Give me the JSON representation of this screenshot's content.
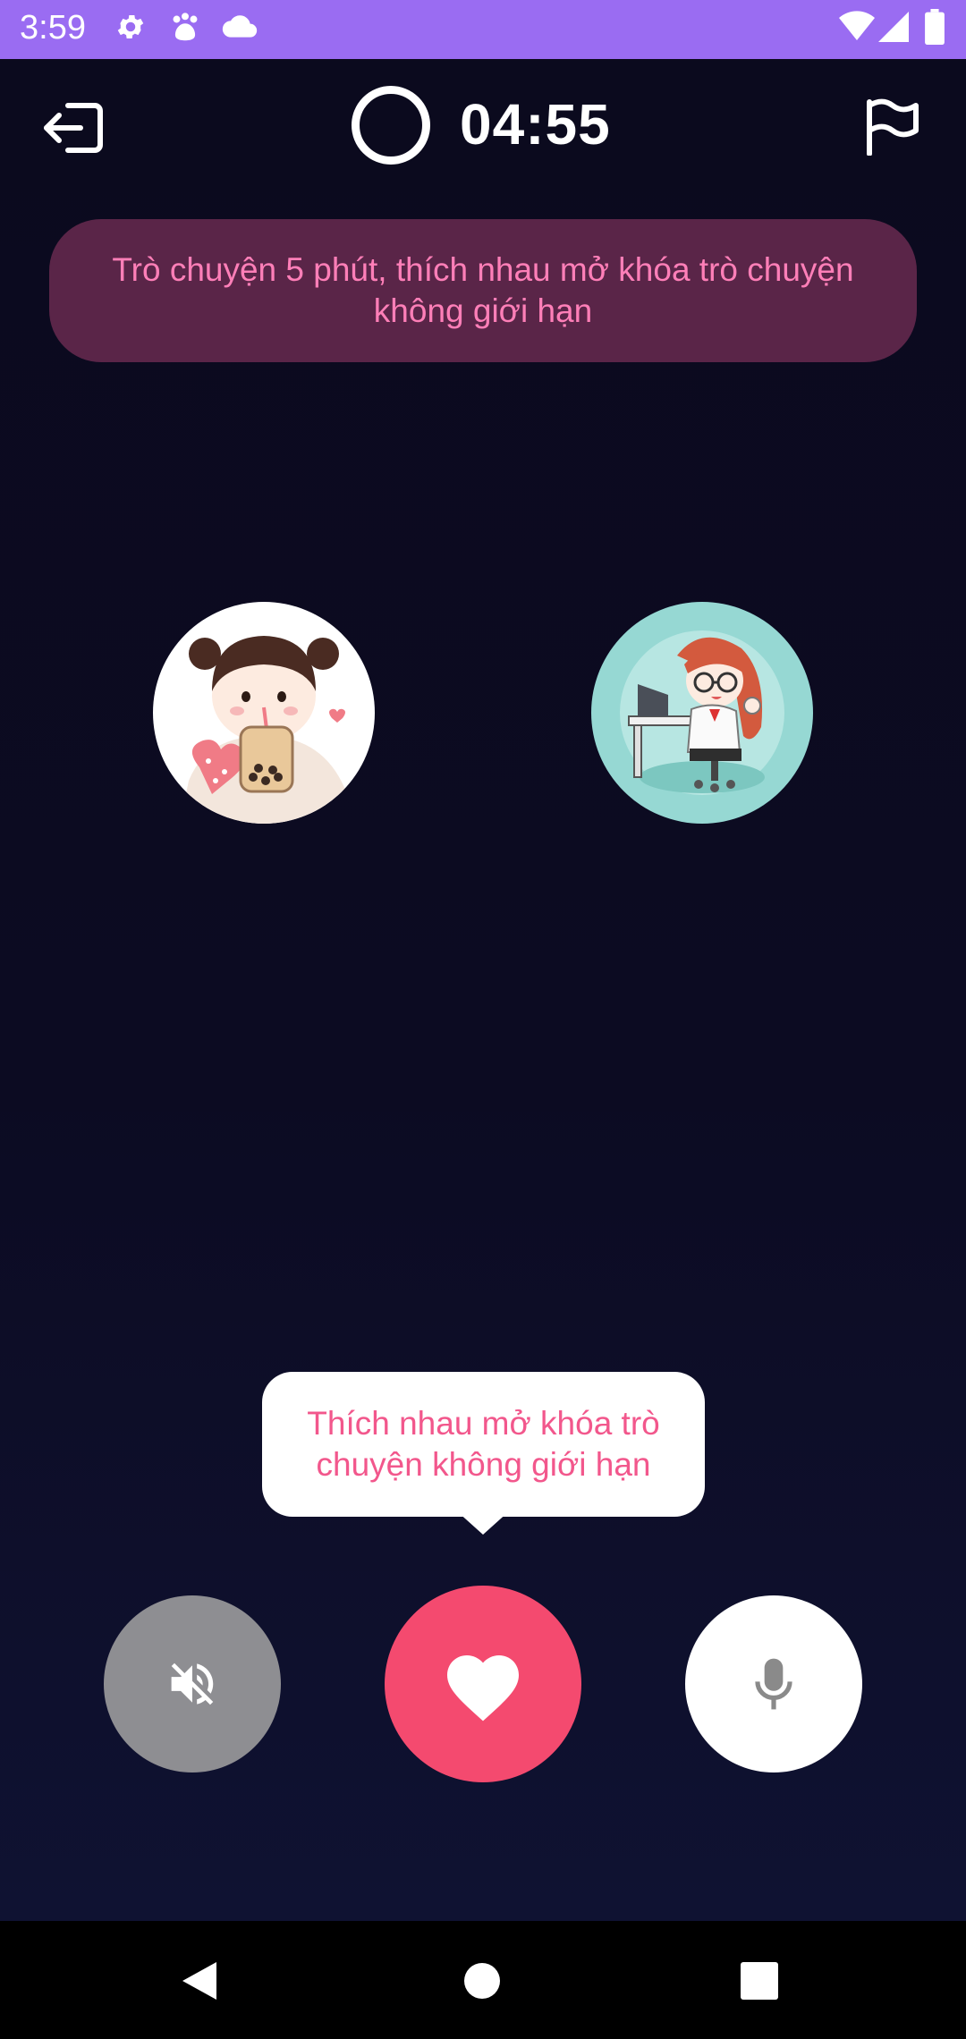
{
  "status_bar": {
    "time": "3:59",
    "icons": [
      "settings-icon",
      "paw-icon",
      "cloud-icon",
      "wifi-icon",
      "cellular-icon",
      "battery-icon"
    ]
  },
  "call": {
    "timer": "04:55",
    "banner_text": "Trò chuyện 5 phút, thích nhau mở khóa trò chuyện không giới hạn",
    "tooltip_text": "Thích nhau mở khóa trò chuyện không giới hạn",
    "participants": [
      {
        "name": "avatar-left",
        "description": "girl-with-bubble-tea"
      },
      {
        "name": "avatar-right",
        "description": "girl-at-desk"
      }
    ]
  },
  "controls": {
    "mute_icon": "speaker-muted-icon",
    "like_icon": "heart-icon",
    "mic_icon": "microphone-icon"
  },
  "colors": {
    "status_bar": "#9a6cf2",
    "background": "#0b0a1e",
    "banner_bg": "#5a2548",
    "banner_text": "#ff7fb8",
    "like_button": "#f44a6f",
    "mute_button": "#8e8e92",
    "mic_button": "#ffffff"
  }
}
